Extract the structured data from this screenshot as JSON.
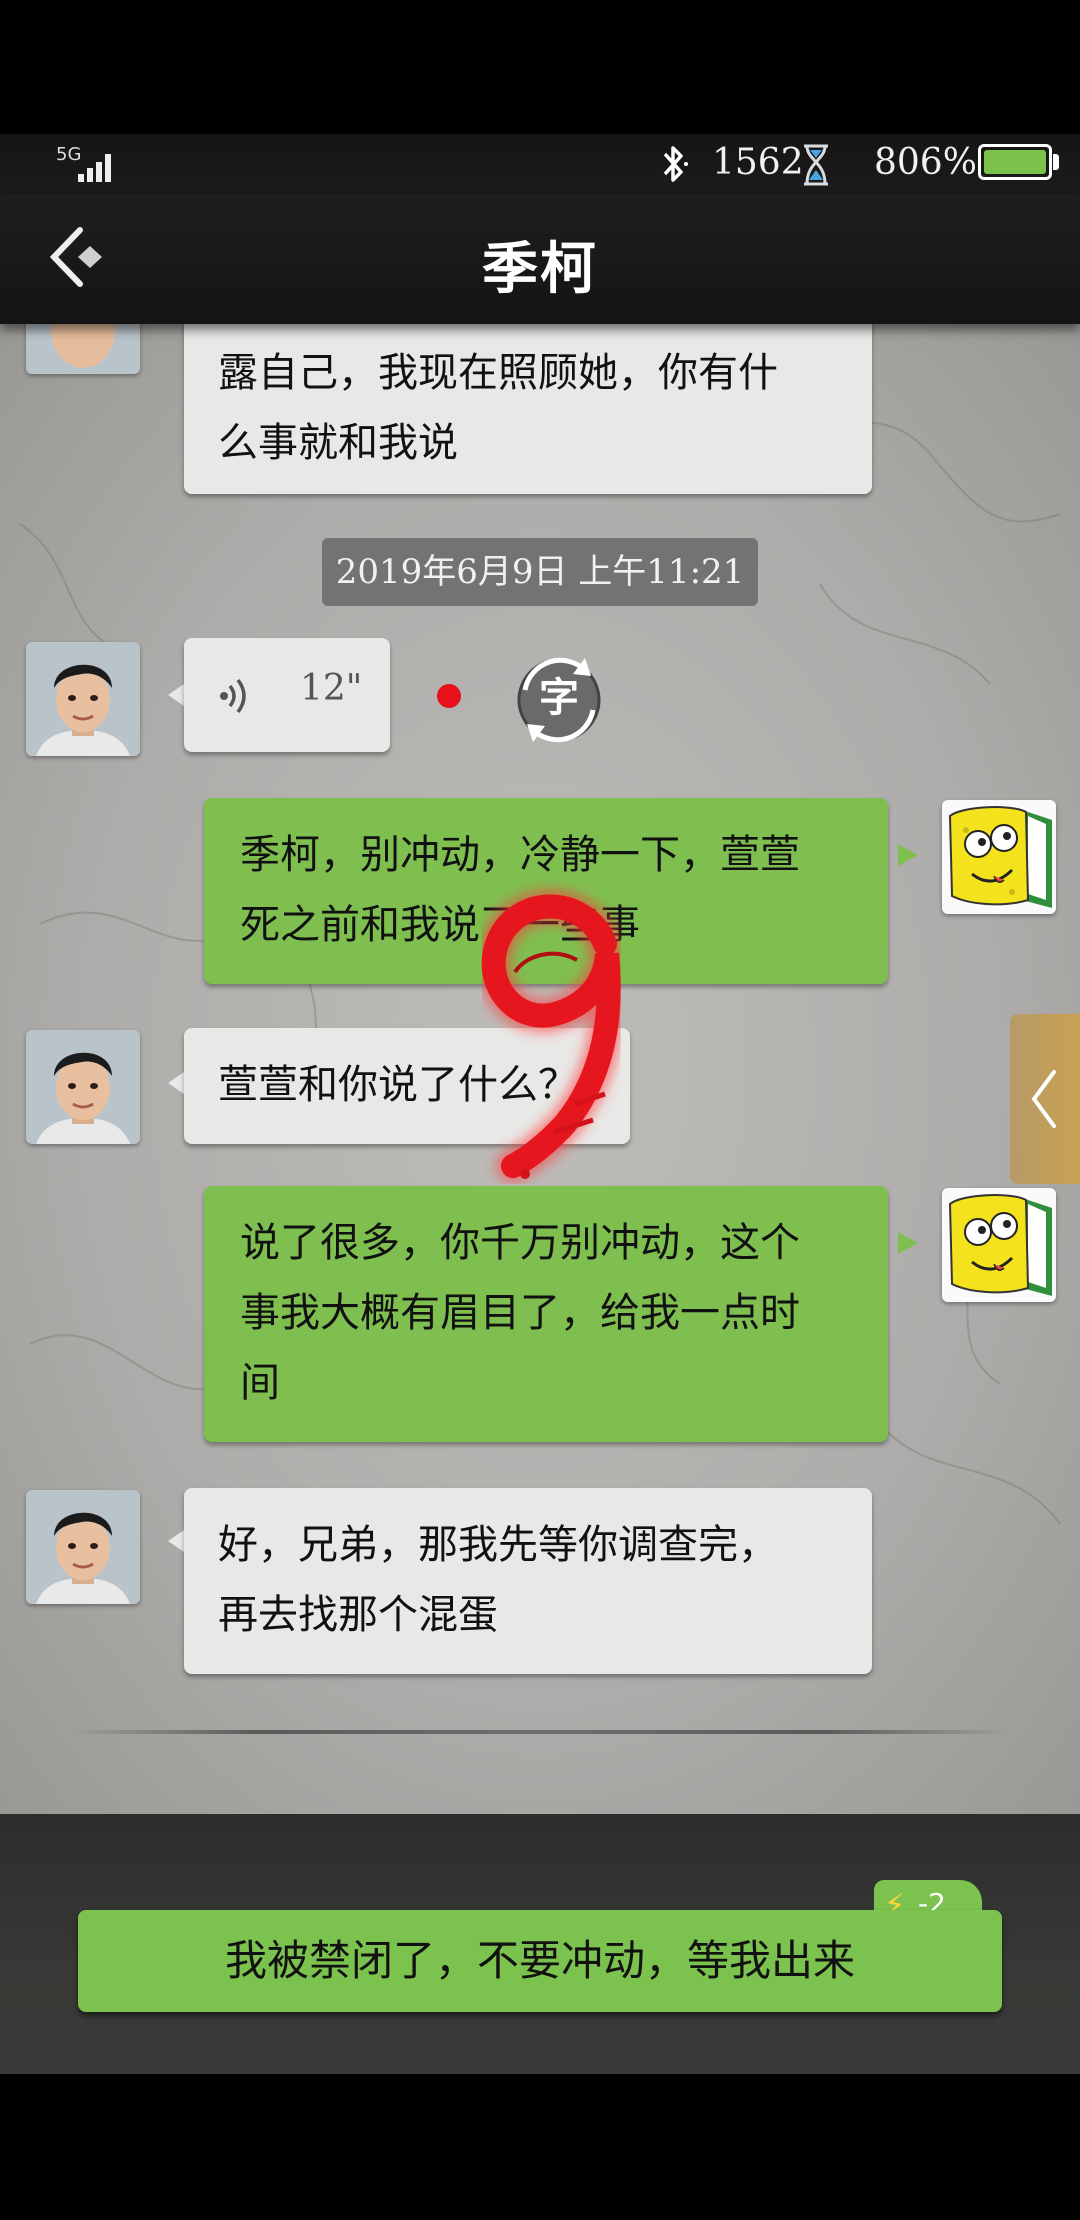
{
  "status_bar": {
    "network": "5G",
    "points": "1562",
    "battery_percent": "806%",
    "battery_level": 0.9
  },
  "header": {
    "title": "季柯"
  },
  "chat": {
    "messages": [
      {
        "sender": "contact",
        "lines": [
          "露自己，我现在照顾她，你有什",
          "么事就和我说"
        ]
      },
      {
        "type": "timestamp",
        "text": "2019年6月9日 上午11:21"
      },
      {
        "sender": "contact",
        "type": "voice",
        "duration": "12\"",
        "transcribe_label": "字"
      },
      {
        "sender": "me",
        "lines": [
          "季柯，别冲动，冷静一下，萱萱",
          "死之前和我说了一些事"
        ]
      },
      {
        "sender": "contact",
        "lines": [
          "萱萱和你说了什么？"
        ]
      },
      {
        "sender": "me",
        "lines": [
          "说了很多，你千万别冲动，这个",
          "事我大概有眉目了，给我一点时",
          "间"
        ]
      },
      {
        "sender": "contact",
        "lines": [
          "好，兄弟，那我先等你调查完，",
          "再去找那个混蛋"
        ]
      }
    ],
    "overlay_number": "9"
  },
  "reply": {
    "text": "我被禁闭了，不要冲动，等我出来",
    "energy_cost": "-2"
  },
  "colors": {
    "my_bubble": "#7fbf50",
    "their_bubble": "#e8e8e6",
    "header_bg": "#1a1a1a",
    "unread_dot": "#e8101a"
  }
}
